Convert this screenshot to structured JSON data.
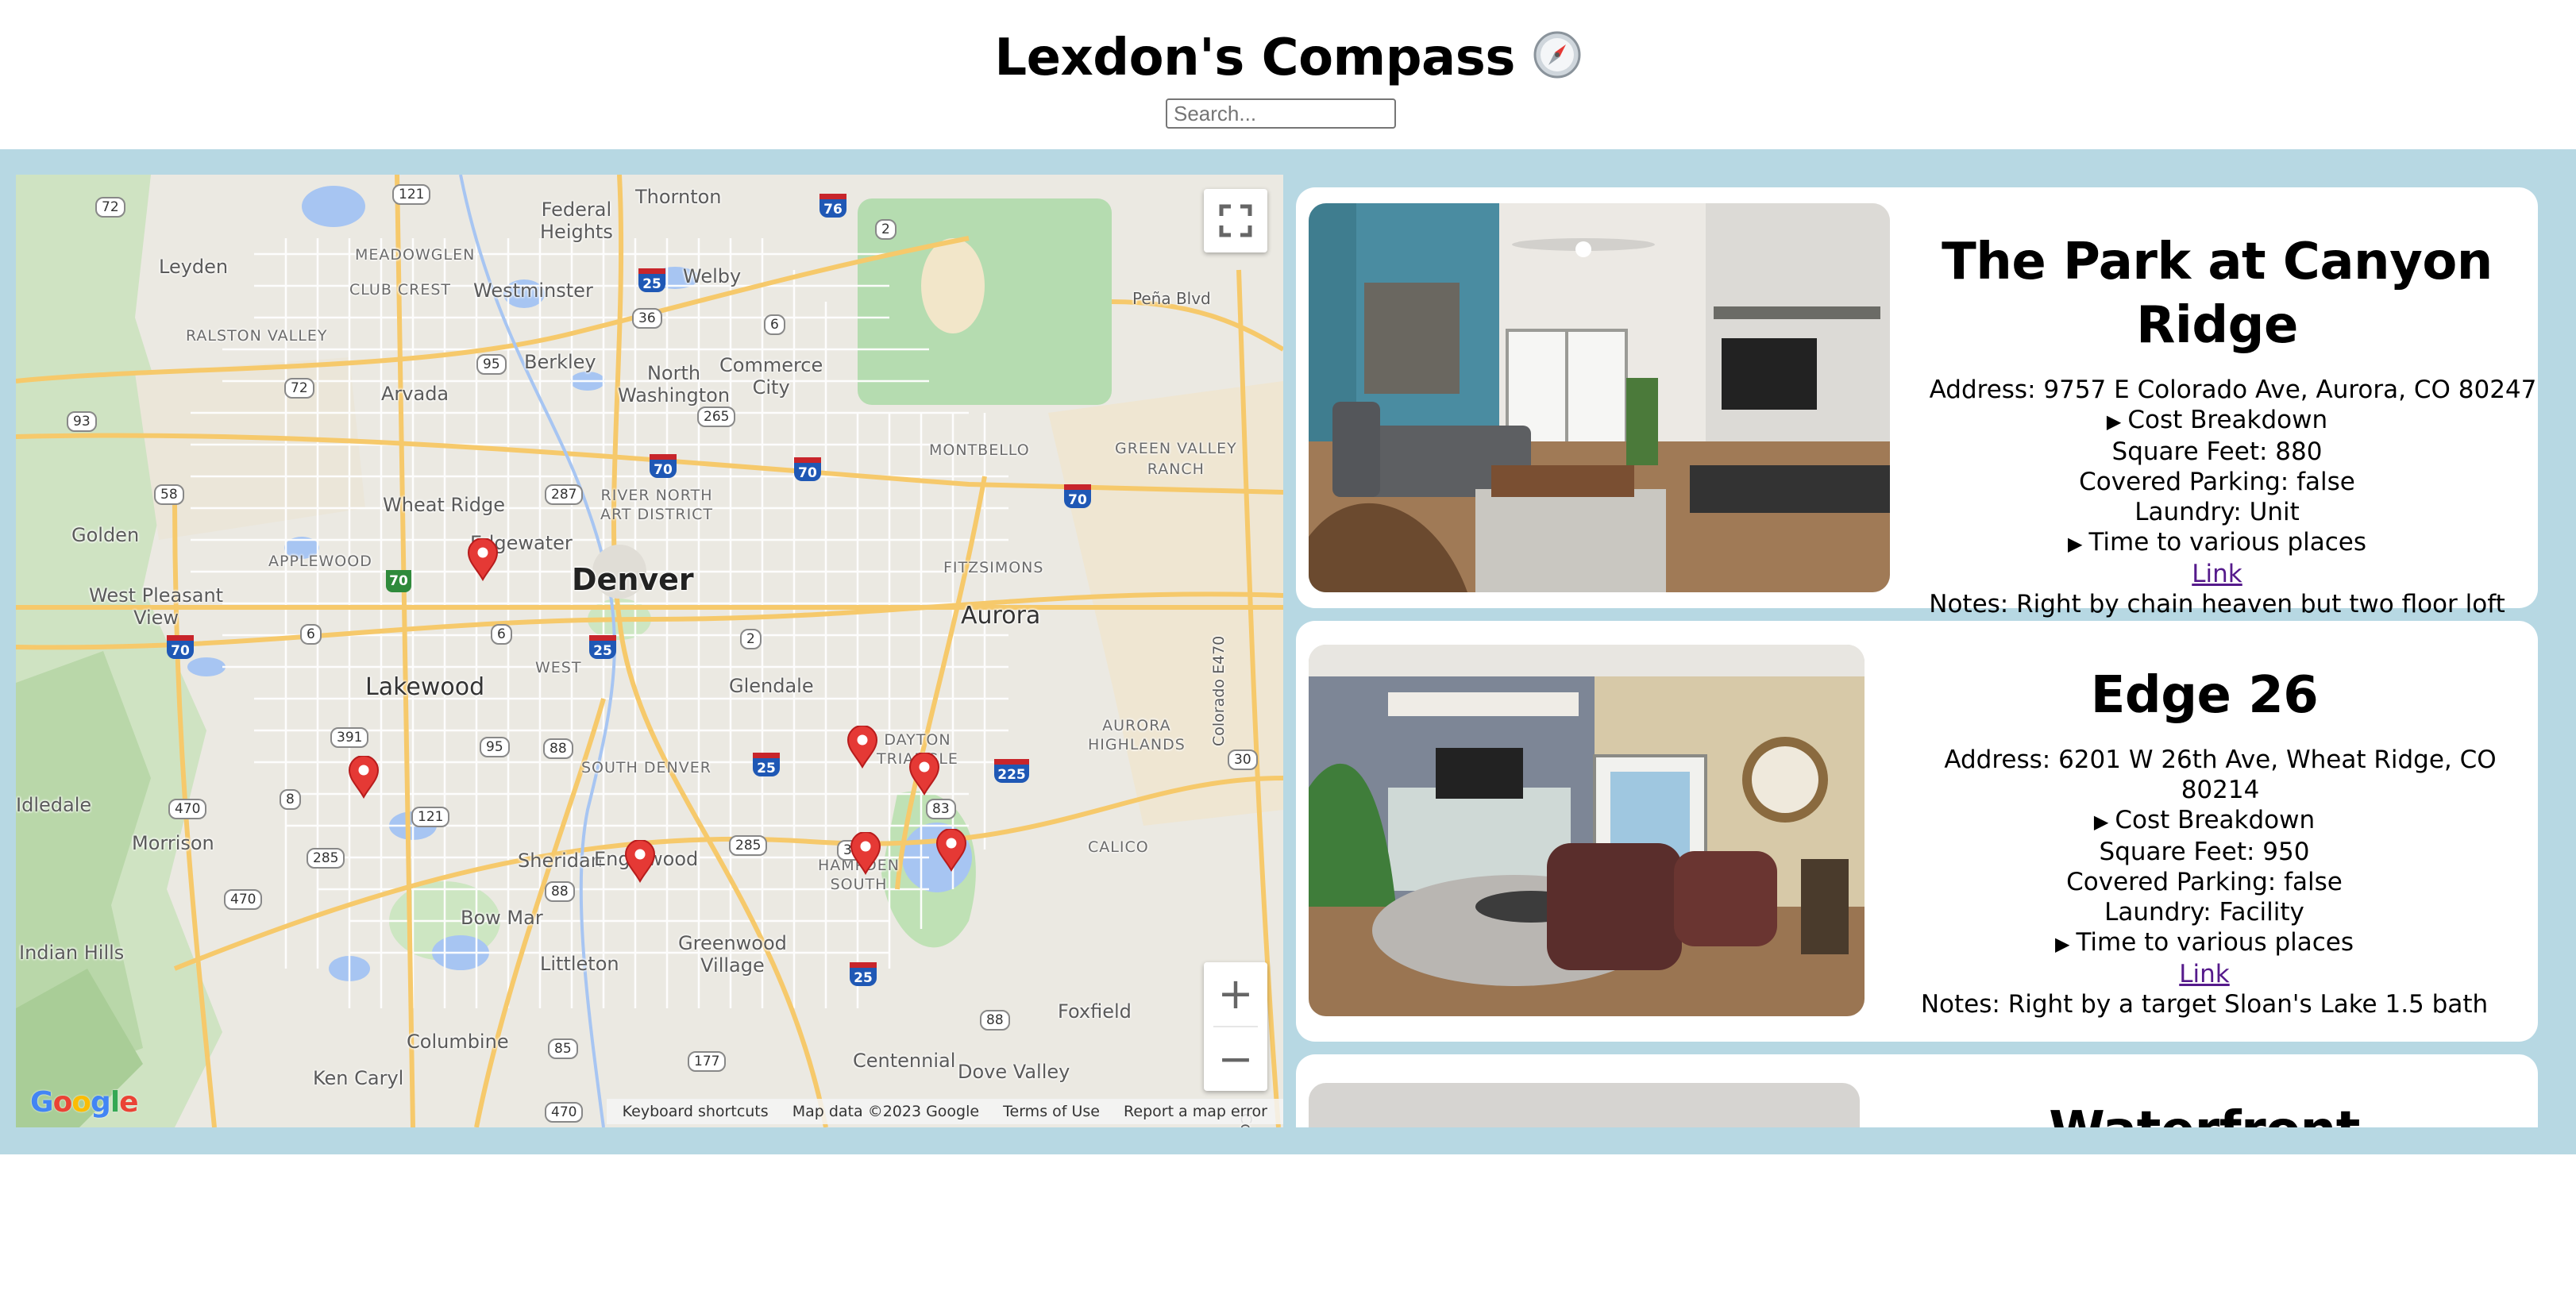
{
  "header": {
    "title": "Lexdon's Compass",
    "title_icon": "compass-emoji",
    "search_placeholder": "Search..."
  },
  "map": {
    "labels": {
      "denver": "Denver",
      "aurora": "Aurora",
      "lakewood": "Lakewood",
      "englewood": "Englewood",
      "thornton": "Thornton",
      "federal_heights": "Federal\nHeights",
      "westminster": "Westminster",
      "welby": "Welby",
      "leyden": "Leyden",
      "meadowglen": "MEADOWGLEN",
      "club_crest": "CLUB CREST",
      "ralston_valley": "RALSTON VALLEY",
      "berkley": "Berkley",
      "north_washington": "North\nWashington",
      "commerce_city": "Commerce\nCity",
      "arvada": "Arvada",
      "montbello": "MONTBELLO",
      "green_valley_ranch": "GREEN VALLEY\nRANCH",
      "wheat_ridge": "Wheat Ridge",
      "river_north": "RIVER NORTH\nART DISTRICT",
      "golden": "Golden",
      "edgewater": "Edgewater",
      "applewood": "APPLEWOOD",
      "fitzsimons": "FITZSIMONS",
      "west_pleasant_view": "West Pleasant\nView",
      "west": "WEST",
      "glendale": "Glendale",
      "aurora_highlands": "AURORA\nHIGHLANDS",
      "dayton_triangle": "DAYTON\nTRIANGLE",
      "south_denver": "SOUTH DENVER",
      "idledale": "Idledale",
      "morrison": "Morrison",
      "sheridan": "Sheridan",
      "hampden_south": "HAMPDEN\nSOUTH",
      "calico": "CALICO",
      "bow_mar": "Bow Mar",
      "greenwood_village": "Greenwood\nVillage",
      "littleton": "Littleton",
      "indian_hills": "Indian Hills",
      "columbine": "Columbine",
      "foxfield": "Foxfield",
      "ken_caryl": "Ken Caryl",
      "centennial": "Centennial",
      "dove_valley": "Dove Valley",
      "pena_blvd": "Peña Blvd",
      "colorado_e470": "Colorado E470",
      "colorado_e470_lower": "Colorado E470"
    },
    "shields": {
      "s72": "72",
      "s121": "121",
      "s2": "2",
      "s36": "36",
      "s6": "6",
      "s95": "95",
      "s265": "265",
      "s93": "93",
      "s58": "58",
      "s287": "287",
      "s6b": "6",
      "s6c": "6",
      "s2b": "2",
      "s391": "391",
      "s95b": "95",
      "s88": "88",
      "s470": "470",
      "s8": "8",
      "s121b": "121",
      "s285": "285",
      "s470b": "470",
      "s88b": "88",
      "s285b": "285",
      "s30": "30",
      "s83": "83",
      "s88c": "88",
      "s177": "177",
      "s85": "85",
      "s470c": "470",
      "s72b": "72",
      "s30b": "30"
    },
    "interstates": {
      "i76": "76",
      "i25a": "25",
      "i70a": "70",
      "i70b": "70",
      "i70c": "70",
      "i25b": "25",
      "i25c": "25",
      "i225": "225",
      "i25d": "25",
      "i70d": "70"
    },
    "green_shields": {
      "g70": "70"
    },
    "controls": {
      "fullscreen": "fullscreen-icon",
      "zoom_in": "+",
      "zoom_out": "−"
    },
    "google": "Google",
    "attribution": [
      "Keyboard shortcuts",
      "Map data ©2023 Google",
      "Terms of Use",
      "Report a map error"
    ],
    "pin_color": "#e53935"
  },
  "listings": [
    {
      "name": "The Park at Canyon Ridge",
      "address": "Address: 9757 E Colorado Ave, Aurora, CO 80247",
      "cost": "Cost Breakdown",
      "sqft": "Square Feet: 880",
      "parking": "Covered Parking: false",
      "laundry": "Laundry: Unit",
      "time": "Time to various places",
      "link": "Link",
      "notes": "Notes: Right by chain heaven but two floor loft"
    },
    {
      "name": "Edge 26",
      "address": "Address: 6201 W 26th Ave, Wheat Ridge, CO 80214",
      "cost": "Cost Breakdown",
      "sqft": "Square Feet: 950",
      "parking": "Covered Parking: false",
      "laundry": "Laundry: Facility",
      "time": "Time to various places",
      "link": "Link",
      "notes": "Notes: Right by a target Sloan's Lake 1.5 bath"
    },
    {
      "name": "Waterfront"
    }
  ],
  "colors": {
    "panel_bg": "#b7d8e3",
    "link": "#551a8b"
  }
}
